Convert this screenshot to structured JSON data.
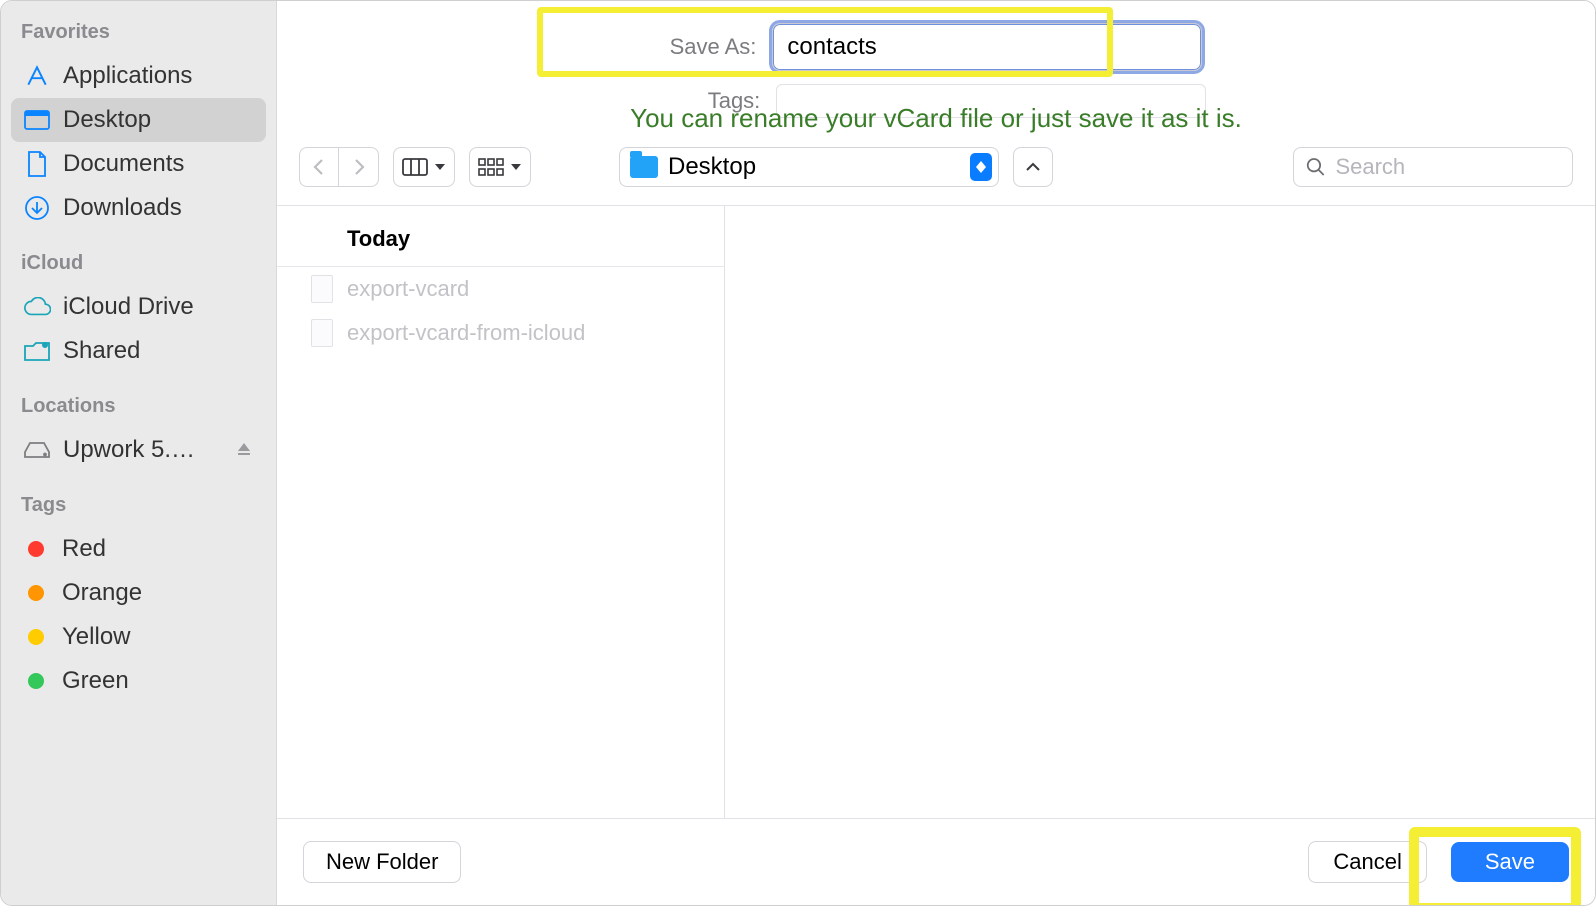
{
  "sidebar": {
    "sections": [
      {
        "title": "Favorites",
        "items": [
          {
            "label": "Applications",
            "icon": "apps",
            "active": false
          },
          {
            "label": "Desktop",
            "icon": "desktop",
            "active": true
          },
          {
            "label": "Documents",
            "icon": "doc",
            "active": false
          },
          {
            "label": "Downloads",
            "icon": "download",
            "active": false
          }
        ]
      },
      {
        "title": "iCloud",
        "items": [
          {
            "label": "iCloud Drive",
            "icon": "cloud"
          },
          {
            "label": "Shared",
            "icon": "shared"
          }
        ]
      },
      {
        "title": "Locations",
        "items": [
          {
            "label": "Upwork 5.…",
            "icon": "disk",
            "eject": true
          }
        ]
      },
      {
        "title": "Tags",
        "items": [
          {
            "label": "Red",
            "color": "#ff3b30"
          },
          {
            "label": "Orange",
            "color": "#ff9500"
          },
          {
            "label": "Yellow",
            "color": "#ffcc00"
          },
          {
            "label": "Green",
            "color": "#34c759"
          }
        ]
      }
    ]
  },
  "save_as": {
    "label": "Save As:",
    "value": "contacts"
  },
  "tags": {
    "label": "Tags:",
    "value": ""
  },
  "annotation": "You can rename your vCard file or just save it as it is.",
  "toolbar": {
    "location": "Desktop",
    "search_placeholder": "Search"
  },
  "browser": {
    "header": "Today",
    "files": [
      {
        "name": "export-vcard"
      },
      {
        "name": "export-vcard-from-icloud"
      }
    ]
  },
  "footer": {
    "new_folder": "New Folder",
    "cancel": "Cancel",
    "save": "Save"
  }
}
